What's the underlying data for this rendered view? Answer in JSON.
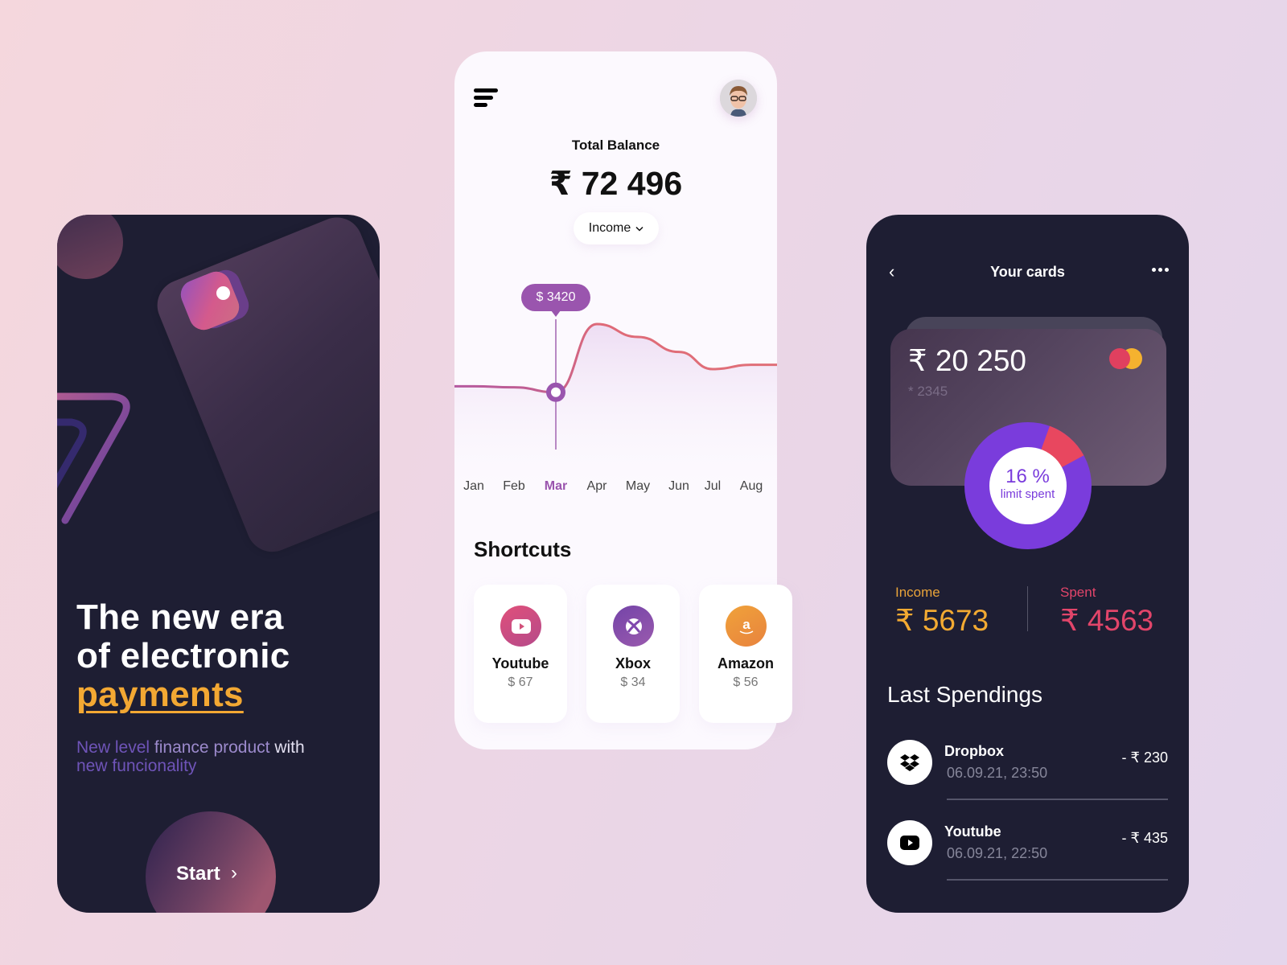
{
  "onboarding": {
    "headline_line1": "The new era",
    "headline_line2": "of electronic",
    "headline_accent": "payments",
    "subtitle_part1": "New level",
    "subtitle_part2": "finance",
    "subtitle_part3": "product",
    "subtitle_part4": "with",
    "subtitle_part5": "new funcionality",
    "start_label": "Start",
    "start_arrow": "›",
    "colors": {
      "background": "#1e1e33",
      "accent": "#f3a833",
      "subtitle": "#6f54b8"
    }
  },
  "dashboard": {
    "menu_icon": "menu-icon",
    "avatar_icon": "user-avatar",
    "total_balance_label": "Total Balance",
    "total_balance_value": "₹ 72 496",
    "filter_selected": "Income",
    "filter_chevron": "⌄",
    "tooltip_value": "$ 3420",
    "active_month": "Mar",
    "months": [
      "Jan",
      "Feb",
      "Mar",
      "Apr",
      "May",
      "Jun",
      "Jul",
      "Aug"
    ],
    "shortcuts_title": "Shortcuts",
    "shortcuts": [
      {
        "name": "Youtube",
        "amount": "$ 67",
        "icon": "youtube-icon",
        "color": "#d2507a"
      },
      {
        "name": "Xbox",
        "amount": "$ 34",
        "icon": "xbox-icon",
        "color": "#8048ad"
      },
      {
        "name": "Amazon",
        "amount": "$ 56",
        "icon": "amazon-icon",
        "color": "#ec933a"
      }
    ]
  },
  "chart_data": {
    "type": "line",
    "title": "",
    "xlabel": "",
    "ylabel": "",
    "categories": [
      "Jan",
      "Feb",
      "Mar",
      "Apr",
      "May",
      "Jun",
      "Jul",
      "Aug"
    ],
    "series": [
      {
        "name": "Income",
        "values": [
          3700,
          3650,
          3420,
          6600,
          6000,
          5300,
          4500,
          4700
        ]
      }
    ],
    "highlight": {
      "category": "Mar",
      "value": 3420,
      "label": "$ 3420"
    },
    "ylim": [
      0,
      9000
    ],
    "grid": false,
    "legend": "none"
  },
  "cards": {
    "back_icon": "‹",
    "title": "Your cards",
    "more_icon": "more-horizontal-icon",
    "card_balance": "₹ 20 250",
    "card_number": "* 2345",
    "card_brand_icon": "mastercard-icon",
    "limit_spent_fraction": 0.16,
    "limit_percent_label": "16 %",
    "limit_label": "limit spent",
    "income_label": "Income",
    "income_value": "₹ 5673",
    "spent_label": "Spent",
    "spent_value": "₹ 4563",
    "last_spendings_title": "Last Spendings",
    "spendings": [
      {
        "name": "Dropbox",
        "datetime": "06.09.21, 23:50",
        "amount": "- ₹ 230",
        "icon": "dropbox-icon"
      },
      {
        "name": "Youtube",
        "datetime": "06.09.21, 22:50",
        "amount": "- ₹ 435",
        "icon": "youtube-icon"
      }
    ],
    "colors": {
      "donut_main": "#7a3cdc",
      "donut_spent": "#e8475f",
      "income": "#f3aa32",
      "spent": "#e2456a"
    }
  }
}
